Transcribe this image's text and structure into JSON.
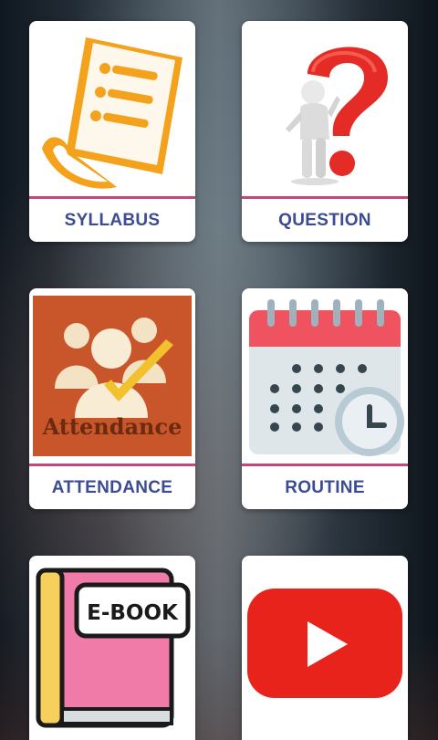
{
  "cards": [
    {
      "label": "SYLLABUS",
      "icon": "syllabus-icon"
    },
    {
      "label": "QUESTION",
      "icon": "question-mark-icon"
    },
    {
      "label": "ATTENDANCE",
      "icon": "attendance-icon",
      "image_text": "Attendance"
    },
    {
      "label": "ROUTINE",
      "icon": "calendar-icon"
    },
    {
      "label": "",
      "icon": "ebook-icon",
      "image_text": "E-BOOK"
    },
    {
      "label": "",
      "icon": "youtube-icon"
    }
  ],
  "colors": {
    "label_text": "#3c4c94",
    "divider": "#c2477a"
  }
}
